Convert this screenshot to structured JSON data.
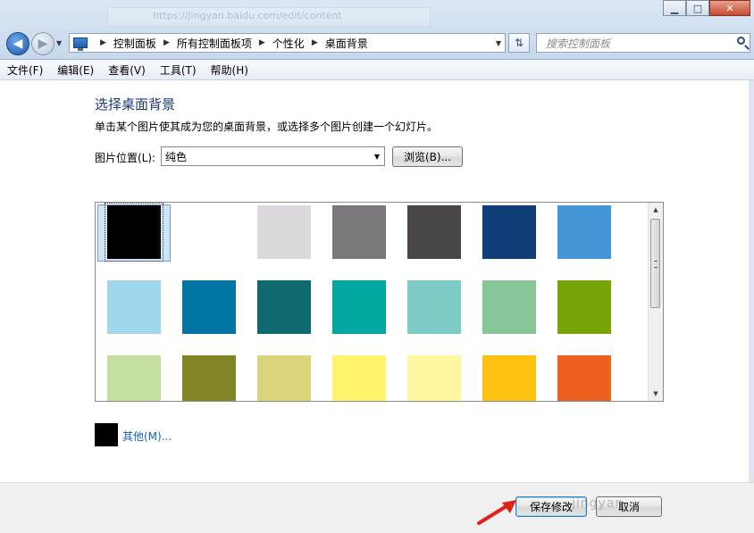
{
  "window": {
    "ghost_url": "https://jingyan.baidu.com/edit/content",
    "controls": {
      "minimize": "▁",
      "maximize": "□",
      "close": "✕"
    }
  },
  "address_bar": {
    "breadcrumbs": [
      "控制面板",
      "所有控制面板项",
      "个性化",
      "桌面背景"
    ]
  },
  "search": {
    "placeholder": "搜索控制面板"
  },
  "menu": [
    "文件(F)",
    "编辑(E)",
    "查看(V)",
    "工具(T)",
    "帮助(H)"
  ],
  "content": {
    "heading": "选择桌面背景",
    "description": "单击某个图片使其成为您的桌面背景，或选择多个图片创建一个幻灯片。",
    "location_label": "图片位置(L):",
    "location_value": "纯色",
    "browse_label": "浏览(B)...",
    "other_label": "其他(M)..."
  },
  "colors": [
    [
      "#000000",
      "#ffffff",
      "#dcd8dd",
      "#7c777c",
      "#4a4548",
      "#0e3d78",
      "#4596d6"
    ],
    [
      "#9fd7ec",
      "#0075a4",
      "#0e6a6e",
      "#00a8a0",
      "#7ecbc6",
      "#88c698",
      "#78a40a"
    ],
    [
      "#c5e09e",
      "#828526",
      "#dbd47a",
      "#fff46c",
      "#fff7a0",
      "#ffc112",
      "#ec6120"
    ]
  ],
  "selected_index": 0,
  "footer": {
    "save_label": "保存修改",
    "cancel_label": "取消"
  },
  "watermark": "jingyan"
}
